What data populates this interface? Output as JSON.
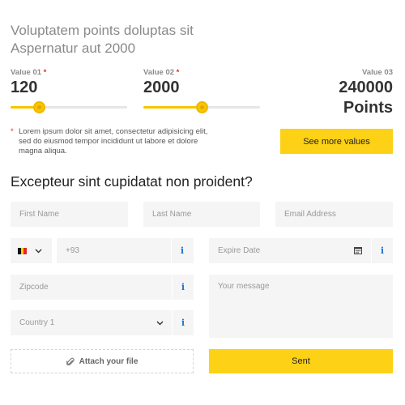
{
  "header": {
    "title_line1": "Voluptatem points doluptas sit",
    "title_line2": "Aspernatur aut 2000"
  },
  "values": [
    {
      "label": "Value 01",
      "required_mark": "*",
      "value": "120",
      "slider_percent": 24
    },
    {
      "label": "Value 02",
      "required_mark": "*",
      "value": "2000",
      "slider_percent": 50
    },
    {
      "label": "Value 03",
      "value": "240000",
      "unit": "Points"
    }
  ],
  "note": {
    "mark": "*",
    "text": "Lorem ipsum dolor sit amet, consectetur adipisicing elit, sed do eiusmod tempor incididunt ut labore et dolore magna aliqua."
  },
  "see_more_label": "See more values",
  "form": {
    "heading": "Excepteur sint cupidatat non proident?",
    "first_name_placeholder": "First Name",
    "last_name_placeholder": "Last Name",
    "email_placeholder": "Email Address",
    "phone_prefix": "+93",
    "expire_date_placeholder": "Expire Date",
    "zipcode_placeholder": "Zipcode",
    "country_value": "Country 1",
    "message_placeholder": "Your message",
    "attach_label": "Attach your file",
    "submit_label": "Sent",
    "info_glyph": "i"
  },
  "icons": {
    "flag": "belgium-flag-icon",
    "chevron": "chevron-down-icon",
    "calendar": "calendar-icon",
    "paperclip": "paperclip-icon"
  },
  "colors": {
    "accent": "#fcd116",
    "required": "#e02b2b",
    "info": "#1976d2",
    "field_bg": "#f5f5f5"
  }
}
